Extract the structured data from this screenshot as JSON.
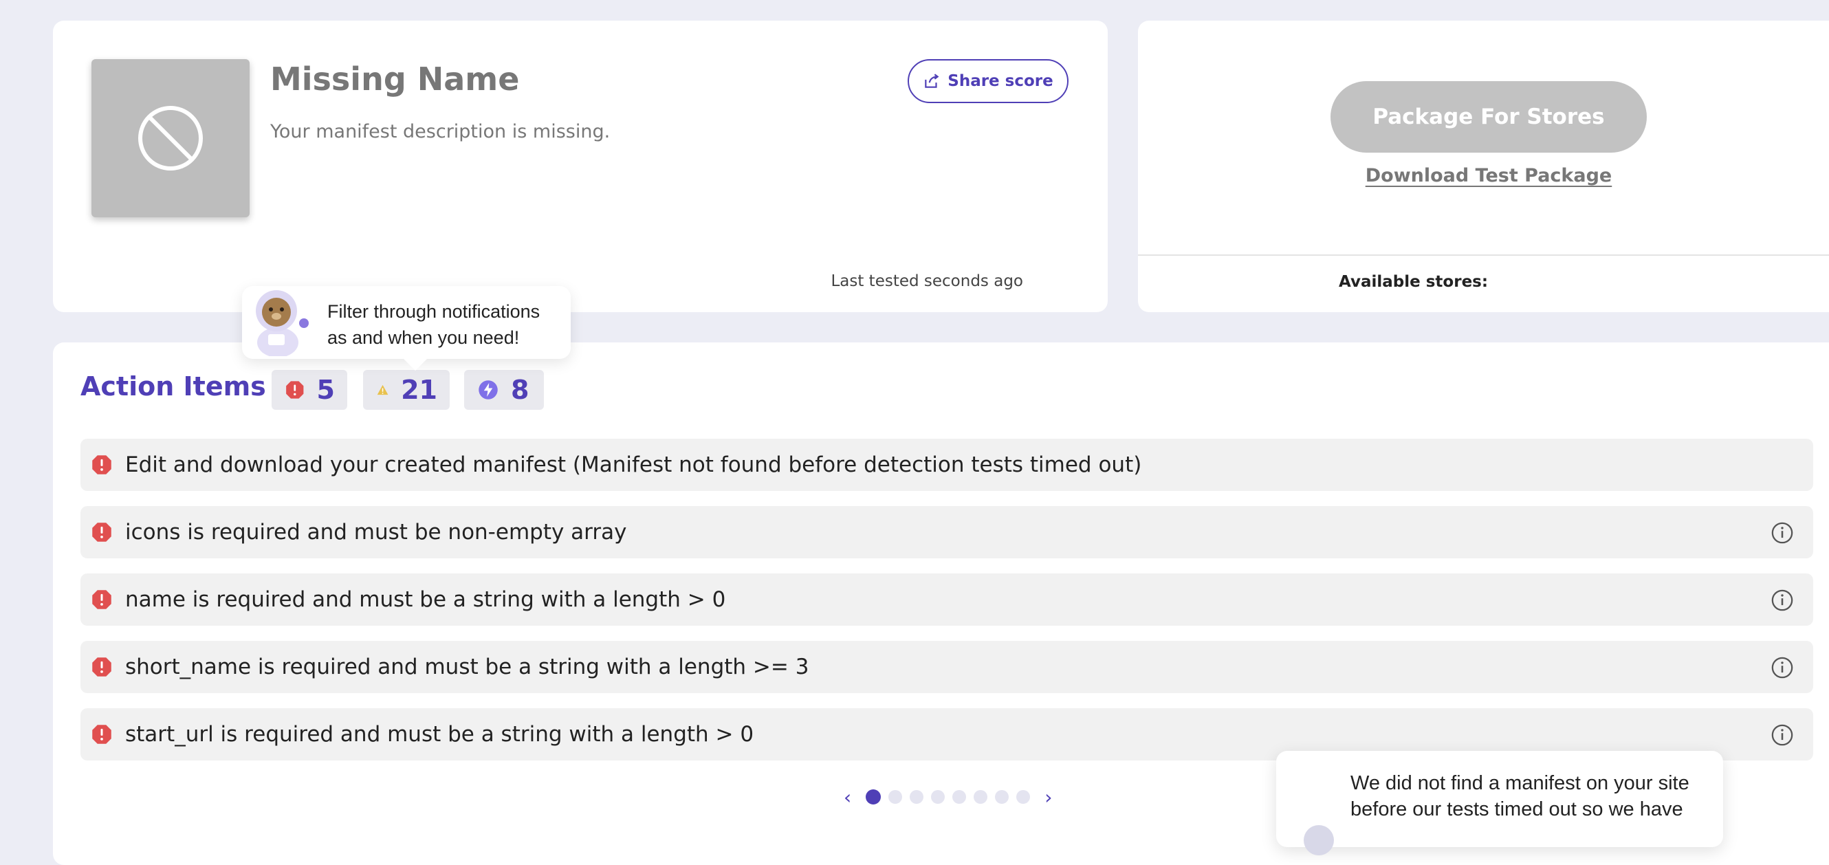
{
  "app": {
    "name": "Missing Name",
    "description": "Your manifest description is missing.",
    "share_label": "Share score",
    "last_tested": "Last tested seconds ago"
  },
  "store": {
    "package_label": "Package For Stores",
    "download_label": "Download Test Package",
    "available_label": "Available stores:"
  },
  "action_items": {
    "title": "Action Items",
    "counts": {
      "errors": "5",
      "warnings": "21",
      "enhancements": "8"
    },
    "items": [
      {
        "text": "Edit and download your created manifest (Manifest not found before detection tests timed out)",
        "has_info": false
      },
      {
        "text": "icons is required and must be non-empty array",
        "has_info": true
      },
      {
        "text": "name is required and must be a string with a length > 0",
        "has_info": true
      },
      {
        "text": "short_name is required and must be a string with a length >= 3",
        "has_info": true
      },
      {
        "text": "start_url is required and must be a string with a length > 0",
        "has_info": true
      }
    ],
    "pager": {
      "pages": 8,
      "current": 1
    }
  },
  "tooltips": {
    "filter": "Filter through notifications as and when you need!",
    "manifest": "We did not find a manifest on your site before our tests timed out so we have"
  },
  "colors": {
    "accent": "#4f3fb6",
    "error": "#e04f4f",
    "warning": "#e8c14e",
    "enhancement": "#7f70e8"
  },
  "icons": [
    "placeholder-no-icon",
    "share-icon",
    "error-icon",
    "warning-icon",
    "lightning-icon",
    "info-icon",
    "chevron-left-icon",
    "chevron-right-icon",
    "mascot-icon"
  ]
}
